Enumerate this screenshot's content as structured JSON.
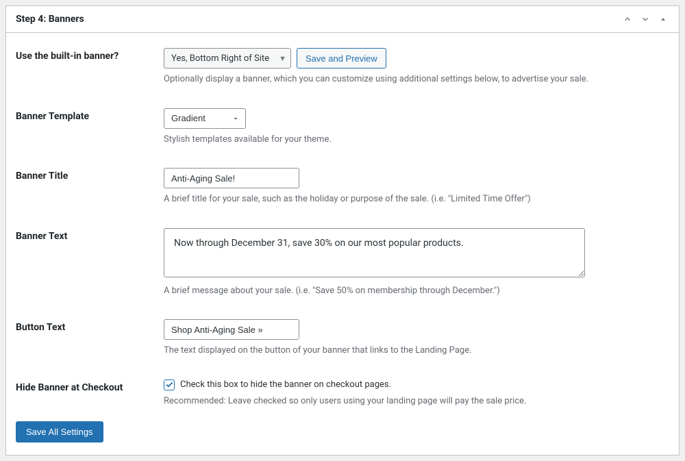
{
  "panel": {
    "title": "Step 4: Banners"
  },
  "builtin": {
    "label": "Use the built-in banner?",
    "select_value": "Yes, Bottom Right of Site",
    "preview_button": "Save and Preview",
    "help": "Optionally display a banner, which you can customize using additional settings below, to advertise your sale."
  },
  "template": {
    "label": "Banner Template",
    "value": "Gradient",
    "help": "Stylish templates available for your theme."
  },
  "title": {
    "label": "Banner Title",
    "value": "Anti-Aging Sale!",
    "help": "A brief title for your sale, such as the holiday or purpose of the sale. (i.e. \"Limited Time Offer\")"
  },
  "text": {
    "label": "Banner Text",
    "value": "Now through December 31, save 30% on our most popular products.",
    "help": "A brief message about your sale. (i.e. \"Save 50% on membership through December.\")"
  },
  "button": {
    "label": "Button Text",
    "value": "Shop Anti-Aging Sale »",
    "help": "The text displayed on the button of your banner that links to the Landing Page."
  },
  "hide": {
    "label": "Hide Banner at Checkout",
    "checkbox_label": "Check this box to hide the banner on checkout pages.",
    "help": "Recommended: Leave checked so only users using your landing page will pay the sale price."
  },
  "save_button": "Save All Settings"
}
